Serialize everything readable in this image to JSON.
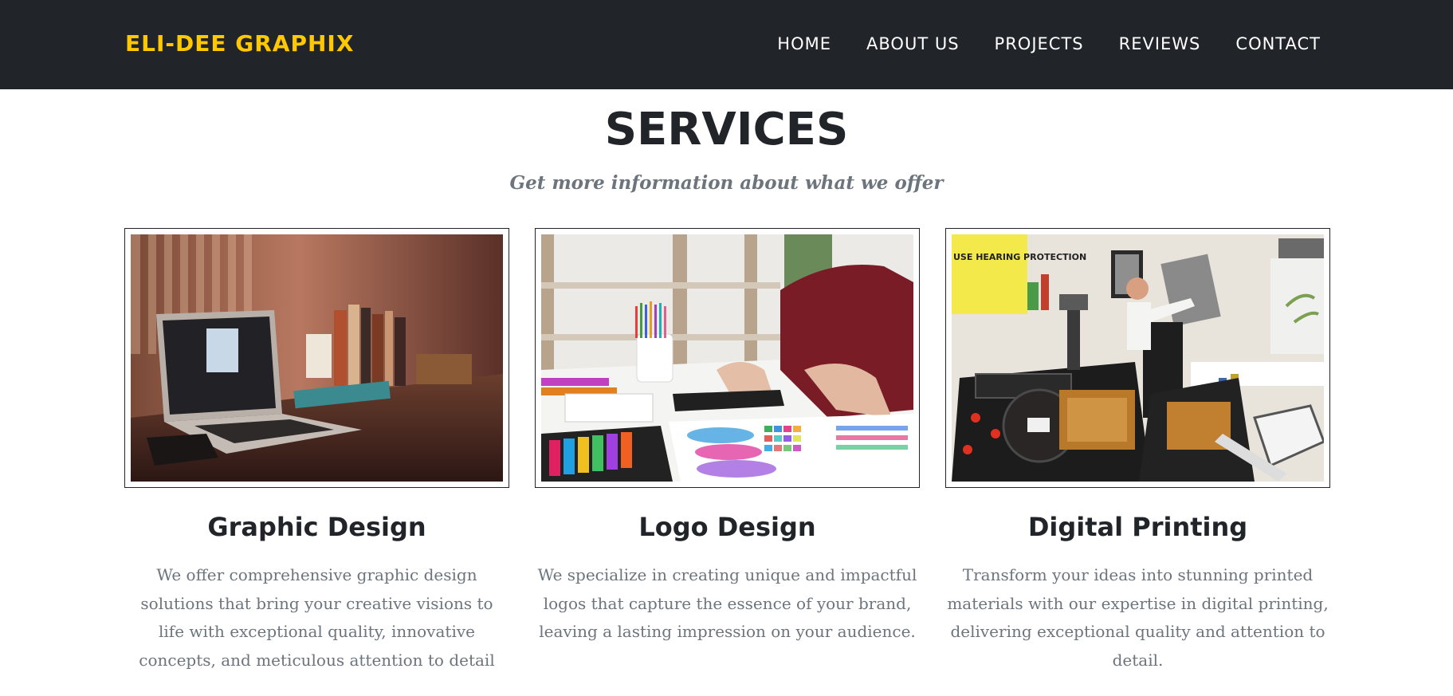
{
  "navbar": {
    "brand": "ELI-DEE GRAPHIX",
    "links": [
      "HOME",
      "ABOUT US",
      "PROJECTS",
      "REVIEWS",
      "CONTACT"
    ]
  },
  "services": {
    "heading": "SERVICES",
    "subheading": "Get more information about what we offer",
    "items": [
      {
        "title": "Graphic Design",
        "text": "We offer comprehensive graphic design solutions that bring your creative visions to life with exceptional quality, innovative concepts, and meticulous attention to detail",
        "image": "laptop-desk-photo"
      },
      {
        "title": "Logo Design",
        "text": "We specialize in creating unique and impactful logos that capture the essence of your brand, leaving a lasting impression on your audience.",
        "image": "designer-color-swatches-photo"
      },
      {
        "title": "Digital Printing",
        "text": "Transform your ideas into stunning printed materials with our expertise in digital printing, delivering exceptional quality and attention to detail.",
        "image": "printing-press-photo",
        "poster_text": "USE HEARING PROTECTION"
      }
    ]
  }
}
